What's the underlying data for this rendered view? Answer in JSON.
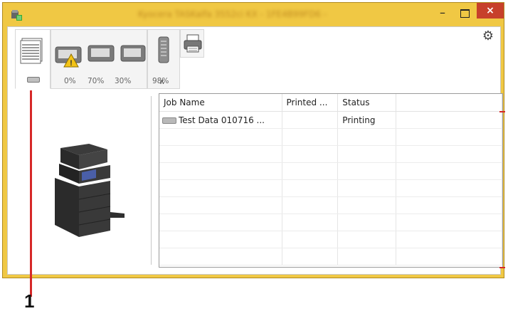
{
  "window": {
    "title": "Kyocera TASKalfa 3552ci KX - 1FE4B99FD6 -",
    "minimize_icon": "minimize-icon",
    "maximize_icon": "maximize-icon",
    "close_icon": "close-icon",
    "close_label": "×"
  },
  "toolbar": {
    "settings_icon": "gear-icon",
    "collapse_label": "∧",
    "toner_levels": [
      "0%",
      "70%",
      "30%"
    ],
    "waste_level": "98%"
  },
  "job_list": {
    "columns": [
      "Job Name",
      "Printed ...",
      "Status",
      ""
    ],
    "rows": [
      {
        "name": "Test Data 010716 ...",
        "printed": "",
        "status": "Printing"
      }
    ]
  },
  "callout": {
    "label": "1"
  },
  "colors": {
    "window_frame": "#f0c844",
    "close_button": "#c7402b",
    "callout": "#d62828"
  }
}
